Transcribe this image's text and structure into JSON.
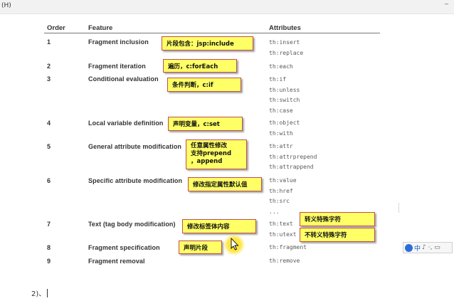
{
  "toolbar": {
    "menu_label": "(H)",
    "corner_mark": "–"
  },
  "table": {
    "headers": [
      "Order",
      "Feature",
      "Attributes"
    ],
    "rows": [
      {
        "order": "1",
        "feature": "Fragment inclusion",
        "attrs": [
          "th:insert",
          "th:replace"
        ]
      },
      {
        "order": "2",
        "feature": "Fragment iteration",
        "attrs": [
          "th:each"
        ]
      },
      {
        "order": "3",
        "feature": "Conditional evaluation",
        "attrs": [
          "th:if",
          "th:unless",
          "th:switch",
          "th:case"
        ]
      },
      {
        "order": "4",
        "feature": "Local variable definition",
        "attrs": [
          "th:object",
          "th:with"
        ]
      },
      {
        "order": "5",
        "feature": "General attribute modification",
        "attrs": [
          "th:attr",
          "th:attrprepend",
          "th:attrappend"
        ]
      },
      {
        "order": "6",
        "feature": "Specific attribute modification",
        "attrs": [
          "th:value",
          "th:href",
          "th:src",
          "..."
        ]
      },
      {
        "order": "7",
        "feature": "Text (tag body modification)",
        "attrs": [
          "th:text",
          "th:utext"
        ]
      },
      {
        "order": "8",
        "feature": "Fragment specification",
        "attrs": [
          "th:fragment"
        ]
      },
      {
        "order": "9",
        "feature": "Fragment removal",
        "attrs": [
          "th:remove"
        ]
      }
    ]
  },
  "notes": {
    "n1": "片段包含：jsp:include",
    "n2": "遍历，c:forEach",
    "n3": "条件判断，c:if",
    "n4": "声明变量，c:set",
    "n5a": "任意属性修改",
    "n5b": "支持prepend",
    "n5c": "，append",
    "n6": "修改指定属性默认值",
    "n7": "修改标签体内容",
    "n7a": "转义特殊字符",
    "n7b": "不转义特殊字符",
    "n8": "声明片段"
  },
  "ime": {
    "text": "中",
    "extras": "♪ ·, ▭"
  },
  "bottom": {
    "text": "2)、"
  }
}
